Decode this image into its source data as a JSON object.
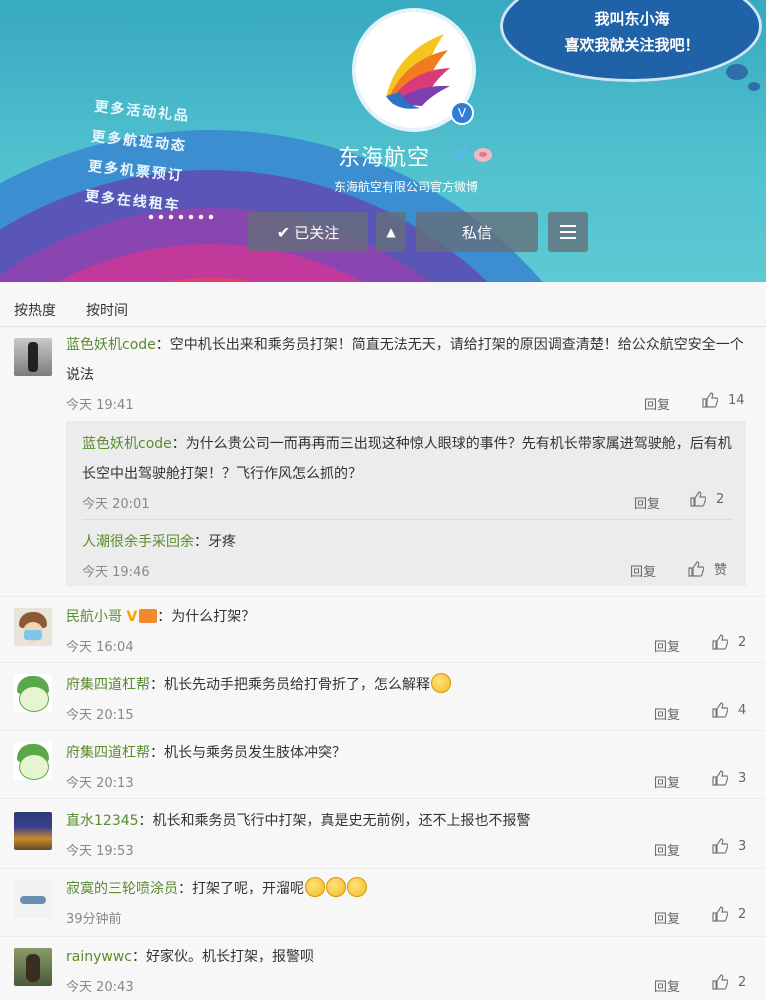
{
  "profile": {
    "bubble_line1": "我叫东小海",
    "bubble_line2": "喜欢我就关注我吧！",
    "promo": [
      "更多活动礼品",
      "更多航班动态",
      "更多机票预订",
      "更多在线租车"
    ],
    "name": "东海航空",
    "gender_symbol": "♂",
    "subtitle": "东海航空有限公司官方微博",
    "follow_check": "✔",
    "follow_label": "已关注",
    "arrow": "▲",
    "message_label": "私信",
    "verified_mark": "V"
  },
  "sort": {
    "hot": "按热度",
    "time": "按时间"
  },
  "comments": [
    {
      "user": "蓝色妖机code",
      "text": "：空中机长出来和乘务员打架！简直无法无天，请给打架的原因调查清楚！给公众航空安全一个说法",
      "time": "今天 19:41",
      "reply_label": "回复",
      "likes": "14"
    },
    {
      "user": "民航小哥",
      "text": "：为什么打架？",
      "time": "今天 16:04",
      "reply_label": "回复",
      "likes": "2"
    },
    {
      "user": "府集四道杠帮",
      "text": "：机长先动手把乘务员给打骨折了，怎么解释",
      "time": "今天 20:15",
      "reply_label": "回复",
      "likes": "4"
    },
    {
      "user": "府集四道杠帮",
      "text": "：机长与乘务员发生肢体冲突？",
      "time": "今天 20:13",
      "reply_label": "回复",
      "likes": "3"
    },
    {
      "user": "直水12345",
      "text": "：机长和乘务员飞行中打架，真是史无前例，还不上报也不报警",
      "time": "今天 19:53",
      "reply_label": "回复",
      "likes": "3"
    },
    {
      "user": "寂寞的三轮喷涂员",
      "text": "：打架了呢，开溜呢",
      "time": "39分钟前",
      "reply_label": "回复",
      "likes": "2"
    },
    {
      "user": "rainywwc",
      "text": "：好家伙。机长打架，报警呗",
      "time": "今天 20:43",
      "reply_label": "回复",
      "likes": "2"
    }
  ],
  "replies": [
    {
      "user": "蓝色妖机code",
      "text": "：为什么贵公司一而再再而三出现这种惊人眼球的事件？先有机长带家属进驾驶舱，后有机长空中出驾驶舱打架！？飞行作风怎么抓的？",
      "time": "今天 20:01",
      "reply_label": "回复",
      "likes": "2"
    },
    {
      "user": "人潮很余手采回余",
      "text": "：牙疼",
      "time": "今天 19:46",
      "reply_label": "回复",
      "likes": "赞"
    }
  ],
  "colors": {
    "username": "#5a8b2e",
    "banner": "#4fbfcd",
    "button": "#6e7680"
  },
  "icons": [
    "check-icon",
    "arrow-up-icon",
    "menu-icon",
    "verified-icon",
    "thumb-up-icon",
    "emoji-icon",
    "gender-male-icon"
  ]
}
